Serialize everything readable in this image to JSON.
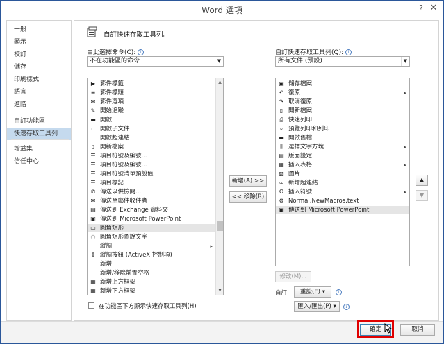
{
  "window": {
    "title": "Word 選項",
    "help": "?",
    "close": "✕"
  },
  "sidebar": {
    "items": [
      {
        "label": "一般"
      },
      {
        "label": "顯示"
      },
      {
        "label": "校訂"
      },
      {
        "label": "儲存"
      },
      {
        "label": "印刷樣式"
      },
      {
        "label": "語言"
      },
      {
        "label": "進階"
      },
      {
        "label": "自訂功能區"
      },
      {
        "label": "快速存取工具列",
        "active": true
      },
      {
        "label": "增益集"
      },
      {
        "label": "信任中心"
      }
    ]
  },
  "main": {
    "header": "自訂快速存取工具列。",
    "left": {
      "label": "由此選擇命令(C):",
      "select_value": "不在功能區的命令",
      "items": [
        {
          "icon": "flag-icon",
          "glyph": "▶",
          "label": "影件標籤"
        },
        {
          "icon": "flag-icon",
          "glyph": "≡",
          "label": "影件標題"
        },
        {
          "icon": "envelope-icon",
          "glyph": "✉",
          "label": "影件選項"
        },
        {
          "icon": "track-icon",
          "glyph": "✎",
          "label": "開始追蹤"
        },
        {
          "icon": "folder-icon",
          "glyph": "▬",
          "label": "開啟"
        },
        {
          "icon": "doc-icon",
          "glyph": "▫",
          "label": "開啟子文件"
        },
        {
          "icon": "link-icon",
          "glyph": "",
          "label": "開啟超連結"
        },
        {
          "icon": "new-doc-icon",
          "glyph": "▯",
          "label": "開新檔案"
        },
        {
          "icon": "list-icon",
          "glyph": "☰",
          "label": "項目符號及編號..."
        },
        {
          "icon": "list-icon",
          "glyph": "☰",
          "label": "項目符號及編號..."
        },
        {
          "icon": "list-icon",
          "glyph": "☰",
          "label": "項目符號清單預設值"
        },
        {
          "icon": "list-icon",
          "glyph": "☰",
          "label": "項目標記"
        },
        {
          "icon": "share-icon",
          "glyph": "✆",
          "label": "傳送以供檢閱..."
        },
        {
          "icon": "mail-icon",
          "glyph": "✉",
          "label": "傳送至郵件收件者"
        },
        {
          "icon": "exchange-icon",
          "glyph": "▤",
          "label": "傳送到 Exchange 資料夾"
        },
        {
          "icon": "ppt-icon",
          "glyph": "▣",
          "label": "傳送到 Microsoft PowerPoint"
        },
        {
          "icon": "shape-icon",
          "glyph": "▭",
          "label": "圓角矩形",
          "selected": true
        },
        {
          "icon": "callout-icon",
          "glyph": "◌",
          "label": "圓角矩形圖說文字"
        },
        {
          "icon": "",
          "glyph": "",
          "label": "縱調",
          "sub": "▸"
        },
        {
          "icon": "spin-icon",
          "glyph": "⇕",
          "label": "縱調按鈕 (ActiveX 控制項)"
        },
        {
          "icon": "",
          "glyph": "",
          "label": "新增"
        },
        {
          "icon": "",
          "glyph": "",
          "label": "新增/移除前置空格"
        },
        {
          "icon": "table-icon",
          "glyph": "▦",
          "label": "新增上方框架"
        },
        {
          "icon": "table-icon",
          "glyph": "▦",
          "label": "新增下方框架"
        }
      ]
    },
    "right": {
      "label": "自訂快速存取工具列(Q):",
      "select_value": "所有文件 (預設)",
      "items": [
        {
          "icon": "save-icon",
          "glyph": "▣",
          "label": "儲存檔案"
        },
        {
          "icon": "undo-icon",
          "glyph": "↶",
          "label": "復原",
          "sub": "▸"
        },
        {
          "icon": "redo-icon",
          "glyph": "↷",
          "label": "取消復原"
        },
        {
          "icon": "new-doc-icon",
          "glyph": "▯",
          "label": "開新檔案"
        },
        {
          "icon": "quick-print-icon",
          "glyph": "⎙",
          "label": "快速列印"
        },
        {
          "icon": "print-preview-icon",
          "glyph": "⌕",
          "label": "預覽列印和列印"
        },
        {
          "icon": "folder-icon",
          "glyph": "▬",
          "label": "開啟舊檔"
        },
        {
          "icon": "text-direction-icon",
          "glyph": "⫼",
          "label": "選擇文字方塊",
          "sub": "▸"
        },
        {
          "icon": "page-setup-icon",
          "glyph": "▤",
          "label": "版面設定"
        },
        {
          "icon": "table-icon",
          "glyph": "▦",
          "label": "插入表格",
          "sub": "▸"
        },
        {
          "icon": "picture-icon",
          "glyph": "▨",
          "label": "圖片"
        },
        {
          "icon": "hyperlink-icon",
          "glyph": "∞",
          "label": "新增超連結"
        },
        {
          "icon": "omega-icon",
          "glyph": "Ω",
          "label": "插入符號",
          "sub": "▸"
        },
        {
          "icon": "macro-icon",
          "glyph": "⚙",
          "label": "Normal.NewMacros.text"
        },
        {
          "icon": "ppt-icon",
          "glyph": "▣",
          "label": "傳送到 Microsoft PowerPoint",
          "selected": true
        }
      ]
    },
    "add_button": "新增(A) >>",
    "remove_button": "<< 移除(R)",
    "move_up": "▲",
    "move_down": "▼",
    "modify_button": "修改(M)...",
    "custom_label": "自訂:",
    "reset_button": "重設(E) ▾",
    "import_export_button": "匯入/匯出(P) ▾",
    "checkbox_label": "在功能區下方顯示快速存取工具列(H)"
  },
  "footer": {
    "ok": "確定",
    "cancel": "取消"
  }
}
